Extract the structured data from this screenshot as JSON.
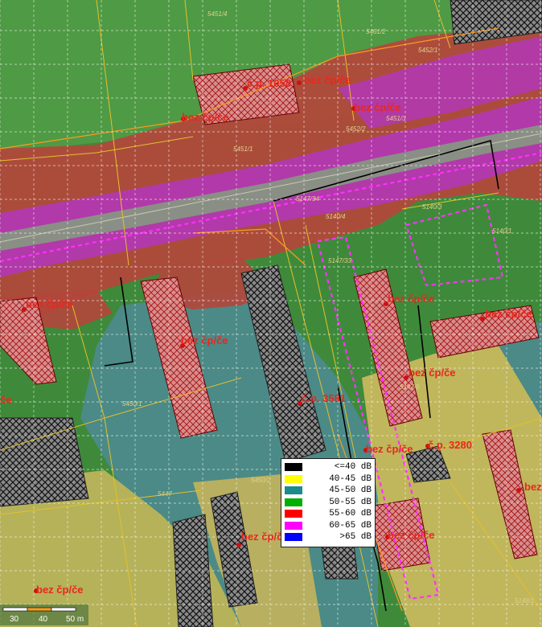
{
  "legend": {
    "items": [
      {
        "label": "<=40 dB",
        "color": "#000000"
      },
      {
        "label": "40-45 dB",
        "color": "#ffff00"
      },
      {
        "label": "45-50 dB",
        "color": "#1a8c8c"
      },
      {
        "label": "50-55 dB",
        "color": "#00b000"
      },
      {
        "label": "55-60 dB",
        "color": "#ff0000"
      },
      {
        "label": "60-65 dB",
        "color": "#ff00ff"
      },
      {
        "label": ">65 dB",
        "color": "#0000ff"
      }
    ]
  },
  "building_labels": {
    "cp_1058": "č.p. 1058",
    "bez_cp_1": "bez čp/če",
    "bez_cp_2": "bez čp/če",
    "bez_cp_3": "bez čp/če",
    "bez_cp_4": "bez čp/če",
    "bez_cp_5": "bez čp/če",
    "bez_cp_6": "bez čp/če",
    "bez_cp_7": "bez čp/če",
    "bez_cp_8": "bez čp/če",
    "bez_cp_9": "bez čp/če",
    "bez_cp_10": "bez čp/če",
    "cp_3280": "č.p. 3280",
    "cp_3581": "č.p. 3581",
    "ce_left": "če"
  },
  "parcel_labels": {
    "p1": "5451/4",
    "p2": "5461/2",
    "p3": "5452/1",
    "p4": "5451/3",
    "p5": "5452/2",
    "p6": "5451/1",
    "p7": "5147/34",
    "p8": "5140/4",
    "p9": "5140/3",
    "p10": "5140/1",
    "p11": "5147/33",
    "p12": "5450/1",
    "p13": "5450/2",
    "p14": "5447",
    "p15": "5147/6",
    "p16": "5148/1"
  },
  "scale": {
    "labels": [
      "30",
      "40",
      "50 m"
    ]
  }
}
